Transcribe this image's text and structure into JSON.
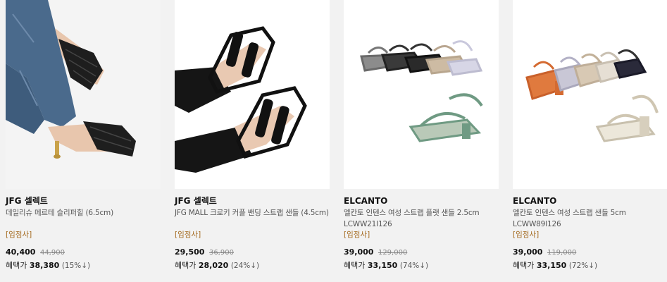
{
  "products": [
    {
      "brand": "JFG 셀렉트",
      "name": "데일리슈 메르테 슬리퍼힐 (6.5cm)",
      "tag": "[입점사]",
      "price": "40,400",
      "original_price": "44,900",
      "benefit_label": "혜택가",
      "benefit_price": "38,380",
      "discount": "(15%↓)"
    },
    {
      "brand": "JFG 셀렉트",
      "name": "JFG MALL 크로키 커플 밴딩 스트랩 샌들 (4.5cm)",
      "tag": "[입점사]",
      "price": "29,500",
      "original_price": "36,900",
      "benefit_label": "혜택가",
      "benefit_price": "28,020",
      "discount": "(24%↓)"
    },
    {
      "brand": "ELCANTO",
      "name": "엘칸토 인텐스 여성 스트랩 플랫 샌들 2.5cm LCWW21I126",
      "tag": "[입점사]",
      "price": "39,000",
      "original_price": "129,000",
      "benefit_label": "혜택가",
      "benefit_price": "33,150",
      "discount": "(74%↓)"
    },
    {
      "brand": "ELCANTO",
      "name": "엘칸토 인텐스 여성 스트랩 샌들 5cm LCWW89I126",
      "tag": "[입점사]",
      "price": "39,000",
      "original_price": "119,000",
      "benefit_label": "혜택가",
      "benefit_price": "33,150",
      "discount": "(72%↓)"
    }
  ]
}
